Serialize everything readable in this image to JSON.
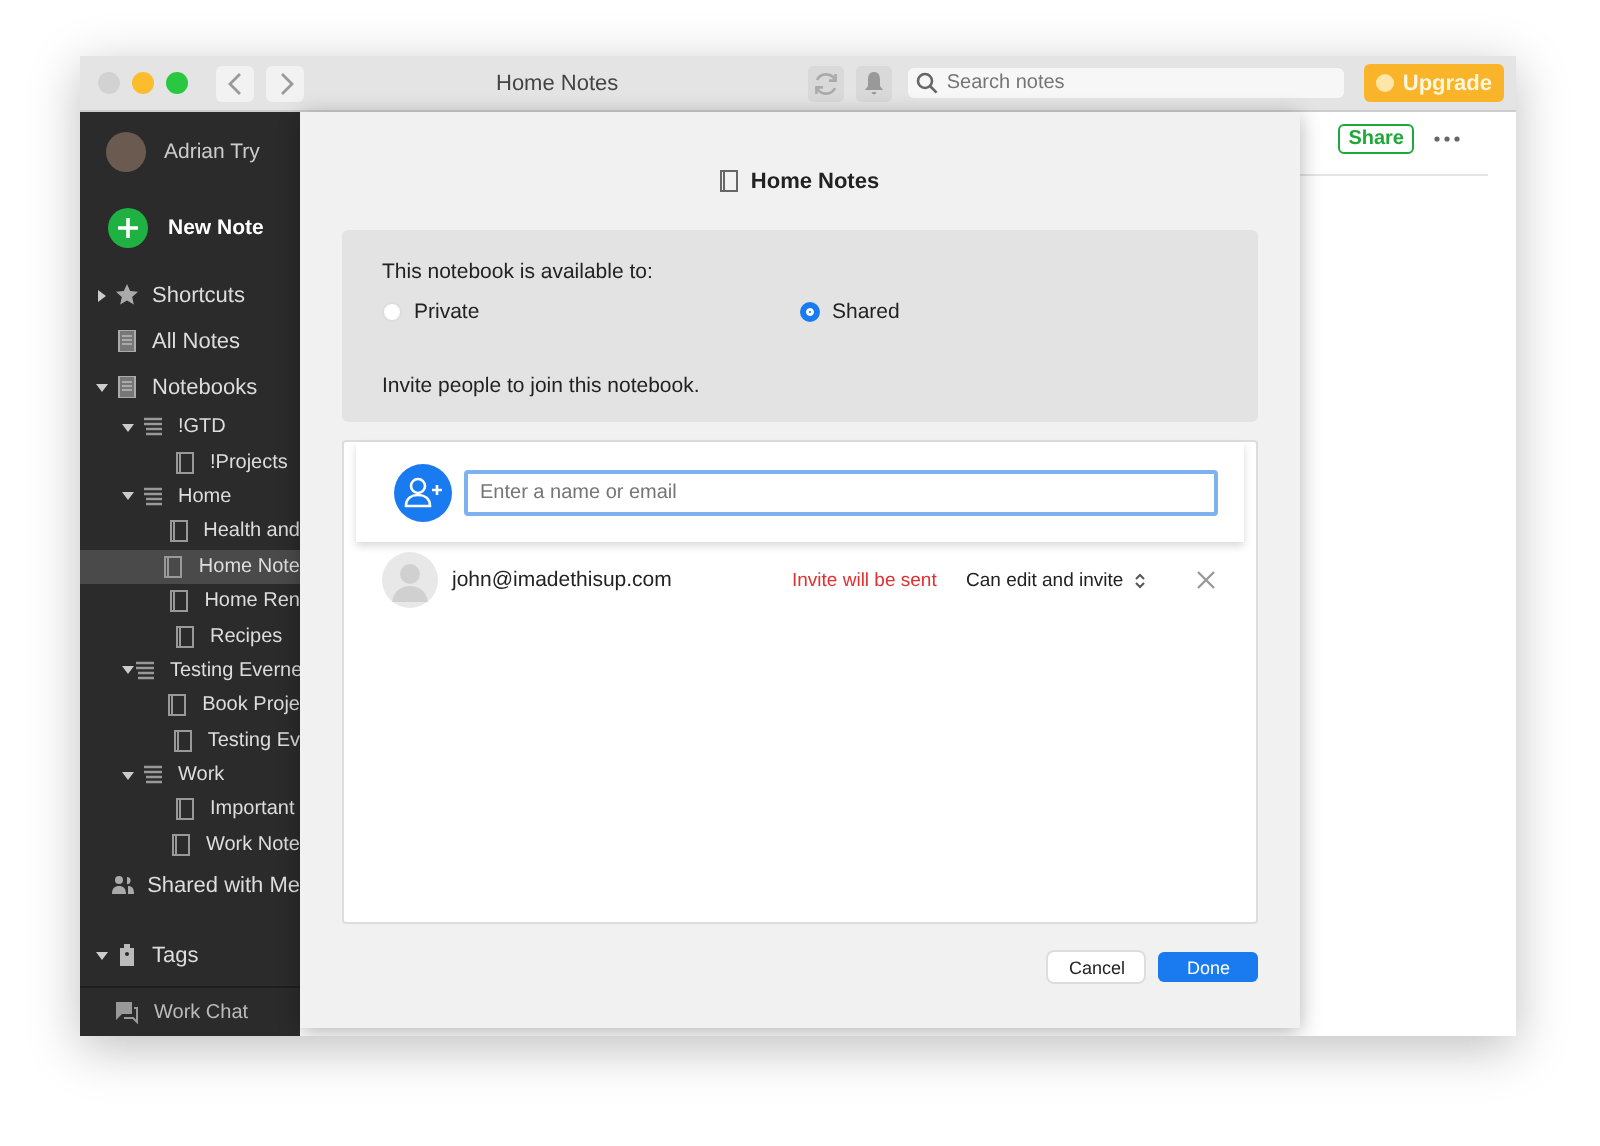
{
  "window": {
    "title": "Home Notes"
  },
  "toolbar": {
    "search": {
      "placeholder": "Search notes"
    },
    "upgrade": "Upgrade"
  },
  "sidebar": {
    "user": "Adrian Try",
    "new_note": "New Note",
    "items": [
      {
        "label": "Shortcuts",
        "kind": "shortcuts",
        "expanded": false
      },
      {
        "label": "All Notes",
        "kind": "notes"
      },
      {
        "label": "Notebooks",
        "kind": "notebooks",
        "expanded": true,
        "children": [
          {
            "label": "!GTD",
            "kind": "stack",
            "expanded": true,
            "children": [
              {
                "label": "!Projects",
                "kind": "notebook",
                "selected": false
              }
            ]
          },
          {
            "label": "Home",
            "kind": "stack",
            "expanded": true,
            "children": [
              {
                "label": "Health and",
                "kind": "notebook",
                "selected": false
              },
              {
                "label": "Home Note",
                "kind": "notebook",
                "selected": true
              },
              {
                "label": "Home Ren",
                "kind": "notebook",
                "selected": false
              },
              {
                "label": "Recipes",
                "kind": "notebook",
                "selected": false
              }
            ]
          },
          {
            "label": "Testing Everne",
            "kind": "stack",
            "expanded": true,
            "children": [
              {
                "label": "Book Proje",
                "kind": "notebook",
                "selected": false
              },
              {
                "label": "Testing Ev",
                "kind": "notebook",
                "selected": false
              }
            ]
          },
          {
            "label": "Work",
            "kind": "stack",
            "expanded": true,
            "children": [
              {
                "label": "Important",
                "kind": "notebook",
                "selected": false
              },
              {
                "label": "Work Note",
                "kind": "notebook",
                "selected": false
              }
            ]
          }
        ]
      },
      {
        "label": "Shared with Me",
        "kind": "shared"
      },
      {
        "label": "Tags",
        "kind": "tags",
        "expanded": true
      }
    ],
    "footer": "Work Chat"
  },
  "dialog": {
    "title": "Home Notes",
    "availability_label": "This notebook is available to:",
    "options": [
      {
        "label": "Private",
        "selected": false
      },
      {
        "label": "Shared",
        "selected": true
      }
    ],
    "invite_label": "Invite people to join this notebook.",
    "invite_field": {
      "placeholder": "Enter a name or email"
    },
    "members": [
      {
        "email": "john@imadethisup.com",
        "status": "Invite will be sent",
        "permission": "Can edit and invite"
      }
    ],
    "buttons": [
      {
        "label": "Cancel",
        "kind": "secondary"
      },
      {
        "label": "Done",
        "kind": "primary"
      }
    ]
  },
  "note": {
    "share": "Share"
  }
}
